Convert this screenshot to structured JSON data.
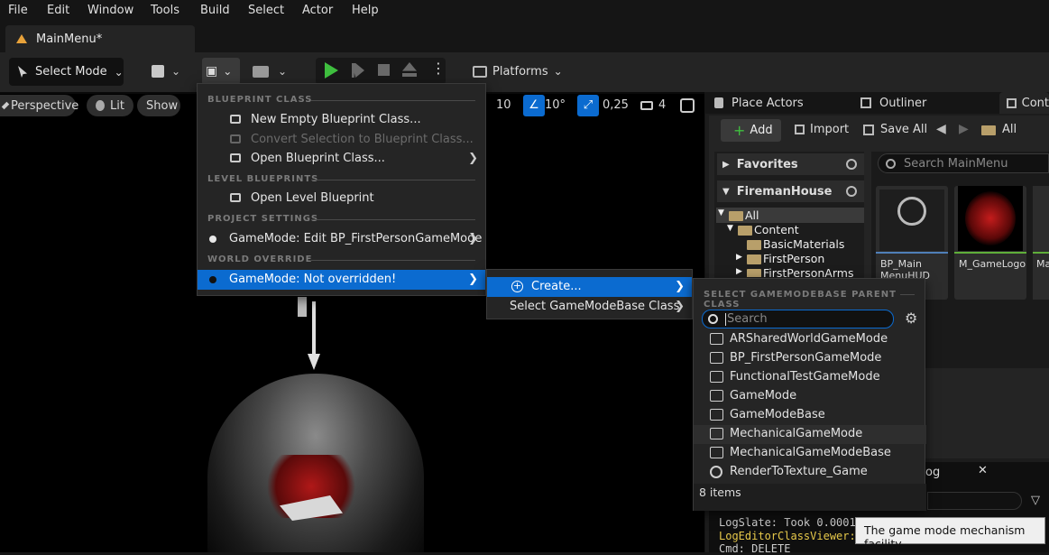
{
  "menubar": {
    "items": [
      "File",
      "Edit",
      "Window",
      "Tools",
      "Build",
      "Select",
      "Actor",
      "Help"
    ]
  },
  "tab": {
    "title": "MainMenu*"
  },
  "toolbar": {
    "select_mode": "Select Mode",
    "platforms": "Platforms"
  },
  "viewport": {
    "perspective": "Perspective",
    "lit": "Lit",
    "show": "Show",
    "grid_snap": "10",
    "rot_snap": "10°",
    "scale_snap": "0,25",
    "cam_speed": "4"
  },
  "panel_tabs": {
    "place_actors": "Place Actors",
    "outliner": "Outliner",
    "content": "Cont"
  },
  "content": {
    "add": "Add",
    "import": "Import",
    "save_all": "Save All",
    "path_all": "All",
    "search_placeholder": "Search MainMenu",
    "favorites": "Favorites",
    "project": "FiremanHouse",
    "tree": [
      "All",
      "Content",
      "BasicMaterials",
      "FirstPerson",
      "FirstPersonArms"
    ],
    "assets": [
      {
        "name": "BP_Main MenuHUD",
        "color": "#4f7fb8"
      },
      {
        "name": "M_GameLogo",
        "color": "#5fae3a"
      },
      {
        "name": "Ma",
        "color": "#5fae3a"
      }
    ]
  },
  "main_menu": {
    "header_blueprint": "BLUEPRINT CLASS",
    "new_blueprint": "New Empty Blueprint Class...",
    "convert": "Convert Selection to Blueprint Class...",
    "open_blueprint": "Open Blueprint Class...",
    "header_level": "LEVEL BLUEPRINTS",
    "open_level": "Open Level Blueprint",
    "header_project": "PROJECT SETTINGS",
    "gamemode_edit": "GameMode: Edit BP_FirstPersonGameMode",
    "header_world": "WORLD OVERRIDE",
    "gamemode_override": "GameMode: Not overridden!"
  },
  "sub_menu": {
    "create": "Create...",
    "select_base": "Select GameModeBase Class"
  },
  "class_picker": {
    "header": "SELECT GAMEMODEBASE PARENT CLASS",
    "search_placeholder": "Search",
    "items": [
      "ARSharedWorldGameMode",
      "BP_FirstPersonGameMode",
      "FunctionalTestGameMode",
      "GameMode",
      "GameModeBase",
      "MechanicalGameMode",
      "MechanicalGameModeBase",
      "RenderToTexture_Game"
    ],
    "count": "8 items"
  },
  "log": {
    "tab": "og",
    "line1": "LogSlate: Took 0.0001",
    "line2": "LogEditorClassViewer:",
    "line3": "Cmd: DELETE"
  },
  "tooltip": "The game mode mechanism facility.",
  "colors": {
    "accent": "#0b6bd0",
    "play_green": "#3fbf3f",
    "log_yellow": "#e6c84a"
  }
}
